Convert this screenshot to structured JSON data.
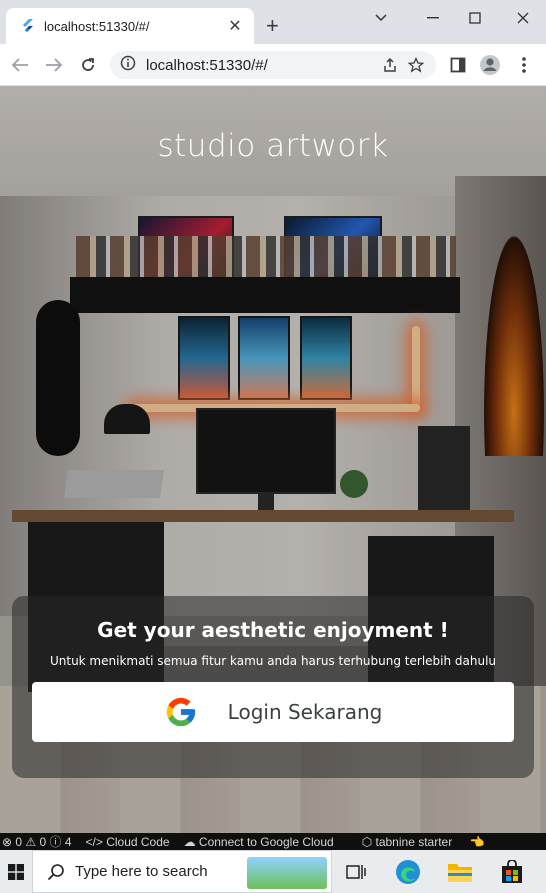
{
  "browser": {
    "tab_title": "localhost:51330/#/",
    "tab_close": "✕",
    "new_tab": "+",
    "url": "localhost:51330/#/"
  },
  "page": {
    "hero_title": "studio artwork",
    "card_title": "Get your aesthetic enjoyment !",
    "card_subtitle": "Untuk menikmati semua fitur kamu anda harus terhubung terlebih dahulu",
    "login_label": "Login Sekarang"
  },
  "statusbar": {
    "problems": "⊗ 0 ⚠ 0 ⓘ 4",
    "cloud_code": "</> Cloud Code",
    "google_cloud": "Connect to Google Cloud",
    "tabnine": "tabnine starter"
  },
  "taskbar": {
    "search_placeholder": "Type here to search"
  },
  "icons": {
    "favicon": "flutter-icon",
    "google": "google-icon"
  },
  "colors": {
    "chrome_tabbar": "#dee1e6",
    "login_button": "#ffffff",
    "card_overlay": "rgba(40,40,40,0.55)"
  }
}
